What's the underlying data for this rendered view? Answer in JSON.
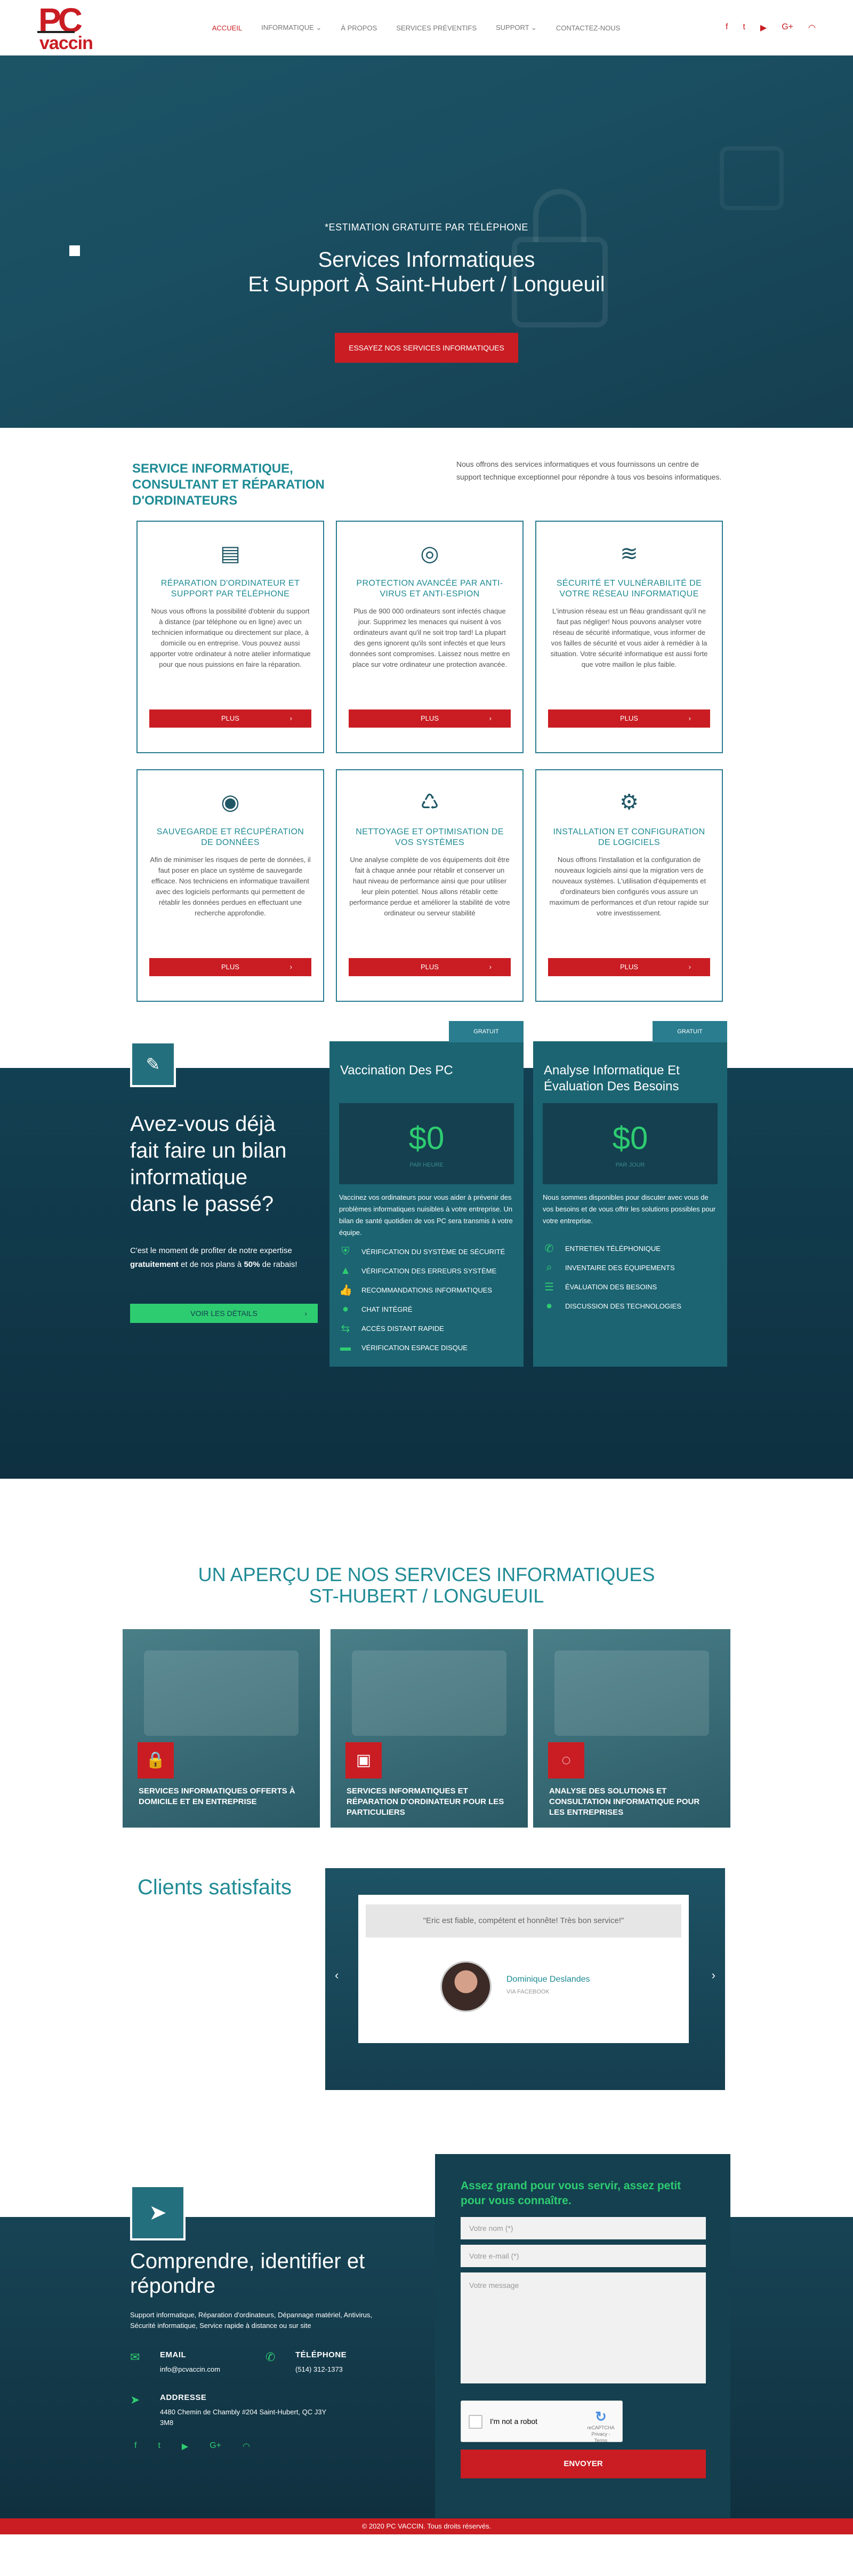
{
  "header": {
    "logo_top": "PC",
    "logo_bottom": "vaccin",
    "nav": [
      {
        "label": "ACCUEIL",
        "active": true
      },
      {
        "label": "INFORMATIQUE",
        "caret": true
      },
      {
        "label": "À PROPOS"
      },
      {
        "label": "SERVICES PRÉVENTIFS"
      },
      {
        "label": "SUPPORT",
        "caret": true
      },
      {
        "label": "CONTACTEZ-NOUS"
      }
    ],
    "social_icons": [
      "facebook-icon",
      "twitter-icon",
      "youtube-icon",
      "google-plus-icon",
      "rss-icon"
    ],
    "social_glyphs": [
      "f",
      "t",
      "▶",
      "G+",
      "◠"
    ]
  },
  "hero": {
    "eyebrow": "*ESTIMATION GRATUITE PAR TÉLÉPHONE",
    "title_line1": "Services Informatiques",
    "title_line2": "Et Support À Saint-Hubert / Longueuil",
    "cta": "ESSAYEZ NOS SERVICES INFORMATIQUES"
  },
  "services": {
    "title": "SERVICE INFORMATIQUE, CONSULTANT ET RÉPARATION D'ORDINATEURS",
    "intro": "Nous offrons des services informatiques et vous fournissons un centre de support technique exceptionnel pour répondre à tous vos besoins informatiques.",
    "cards": [
      {
        "icon": "id-card-icon",
        "glyph": "▤",
        "title": "RÉPARATION D'ORDINATEUR ET SUPPORT PAR TÉLÉPHONE",
        "text": "Nous vous offrons la possibilité d'obtenir du support à distance (par téléphone ou en ligne) avec un technicien informatique ou directement sur place, à domicile ou en entreprise. Vous pouvez aussi apporter votre ordinateur à notre atelier informatique pour que nous puissions en faire la réparation.",
        "button": "PLUS"
      },
      {
        "icon": "lifebuoy-icon",
        "glyph": "◎",
        "title": "PROTECTION AVANCÉE PAR ANTI-VIRUS ET ANTI-ESPION",
        "text": "Plus de 900 000 ordinateurs sont infectés chaque jour. Supprimez les menaces qui nuisent à vos ordinateurs avant qu'il ne soit trop tard! La plupart des gens ignorent qu'ils sont infectés et que leurs données sont compromises. Laissez nous mettre en place sur votre ordinateur une protection avancée.",
        "button": "PLUS"
      },
      {
        "icon": "stack-icon",
        "glyph": "≋",
        "title": "SÉCURITÉ ET VULNÉRABILITÉ DE VOTRE RÉSEAU INFORMATIQUE",
        "text": "L'intrusion réseau est un fléau grandissant qu'il ne faut pas négliger! Nous pouvons analyser votre réseau de sécurité informatique, vous informer de vos failles de sécurité et vous aider à remédier à la situation. Votre sécurité informatique est aussi forte que votre maillon le plus faible.",
        "button": "PLUS"
      },
      {
        "icon": "backup-icon",
        "glyph": "◉",
        "title": "SAUVEGARDE ET RÉCUPÉRATION DE DONNÉES",
        "text": "Afin de minimiser les risques de perte de données, il faut poser en place un système de sauvegarde efficace. Nos techniciens en informatique travaillent avec des logiciels performants qui permettent de rétablir les données perdues en effectuant une recherche approfondie.",
        "button": "PLUS"
      },
      {
        "icon": "recycle-icon",
        "glyph": "♺",
        "title": "NETTOYAGE ET OPTIMISATION DE VOS SYSTÈMES",
        "text": "Une analyse complète de vos équipements doit être fait à chaque année pour rétablir et conserver un haut niveau de performance ainsi que pour utiliser leur plein potentiel. Nous allons rétablir cette performance perdue et améliorer la stabilité de votre ordinateur ou serveur stabilité",
        "button": "PLUS"
      },
      {
        "icon": "gears-icon",
        "glyph": "⚙",
        "title": "INSTALLATION ET CONFIGURATION DE LOGICIELS",
        "text": "Nous offrons l'installation et la configuration de nouveaux logiciels ainsi que la migration vers de nouveaux systèmes. L'utilisation d'équipements et d'ordinateurs bien configurés vous assure un maximum de performances et d'un retour rapide sur votre investissement.",
        "button": "PLUS"
      }
    ]
  },
  "pricing": {
    "icon_glyph": "✎",
    "title": "Avez-vous déjà fait faire un bilan informatique dans le passé?",
    "para_before": "C'est le moment de profiter de notre expertise ",
    "para_bold1": "gratuitement",
    "para_mid": " et de nos plans à ",
    "para_bold2": "50%",
    "para_after": " de rabais!",
    "details": "VOIR LES DÉTAILS",
    "boxes": [
      {
        "badge": "GRATUIT",
        "title": "Vaccination Des PC",
        "amount": "$0",
        "sub": "PAR HEURE",
        "desc": "Vaccinez vos ordinateurs pour vous aider à prévenir des problèmes informatiques nuisibles à votre entreprise. Un bilan de santé quotidien de vos PC sera transmis à votre équipe.",
        "features": [
          {
            "icon": "shield-icon",
            "glyph": "⛨",
            "label": "VÉRIFICATION DU SYSTÈME DE SÉCURITÉ"
          },
          {
            "icon": "warning-icon",
            "glyph": "▲",
            "label": "VÉRIFICATION DES ERREURS SYSTÈME"
          },
          {
            "icon": "thumbs-up-icon",
            "glyph": "👍",
            "label": "RECOMMANDATIONS INFORMATIQUES"
          },
          {
            "icon": "chat-icon",
            "glyph": "●",
            "label": "CHAT INTÉGRÉ"
          },
          {
            "icon": "remote-access-icon",
            "glyph": "⇆",
            "label": "ACCÈS DISTANT RAPIDE"
          },
          {
            "icon": "disk-icon",
            "glyph": "▬",
            "label": "VÉRIFICATION ESPACE DISQUE"
          }
        ]
      },
      {
        "badge": "GRATUIT",
        "title": "Analyse Informatique Et Évaluation Des Besoins",
        "amount": "$0",
        "sub": "PAR JOUR",
        "desc": "Nous sommes disponibles pour discuter avec vous de vos besoins et de vous offrir les solutions possibles pour votre entreprise.",
        "features": [
          {
            "icon": "phone-icon",
            "glyph": "✆",
            "label": "ENTRETIEN TÉLÉPHONIQUE"
          },
          {
            "icon": "search-icon",
            "glyph": "⌕",
            "label": "INVENTAIRE DES ÉQUIPEMENTS"
          },
          {
            "icon": "list-icon",
            "glyph": "☰",
            "label": "ÉVALUATION DES BESOINS"
          },
          {
            "icon": "chat-icon",
            "glyph": "●",
            "label": "DISCUSSION DES TECHNOLOGIES"
          }
        ]
      }
    ]
  },
  "overview": {
    "title_line1": "UN APERÇU DE NOS SERVICES INFORMATIQUES",
    "title_line2": "ST-HUBERT / LONGUEUIL",
    "tiles": [
      {
        "icon": "lock-icon",
        "glyph": "🔒",
        "caption": "SERVICES INFORMATIQUES OFFERTS À DOMICILE ET EN ENTREPRISE"
      },
      {
        "icon": "chip-icon",
        "glyph": "▣",
        "caption": "SERVICES INFORMATIQUES ET RÉPARATION D'ORDINATEUR POUR LES PARTICULIERS"
      },
      {
        "icon": "eye-slash-icon",
        "glyph": "◌",
        "caption": "ANALYSE DES SOLUTIONS ET CONSULTATION INFORMATIQUE POUR LES ENTREPRISES"
      }
    ]
  },
  "clients": {
    "title": "Clients satisfaits",
    "quote": "\"Eric est fiable, compétent et honnête! Très bon service!\"",
    "name": "Dominique Deslandes",
    "via": "VIA FACEBOOK",
    "prev": "‹",
    "next": "›"
  },
  "contact": {
    "icon_glyph": "➤",
    "title": "Comprendre, identifier et répondre",
    "tags": "Support informatique, Réparation d'ordinateurs, Dépannage matériel, Antivirus, Sécurité informatique, Service rapide à distance ou sur site",
    "email_label": "EMAIL",
    "email": "info@pcvaccin.com",
    "phone_label": "TÉLÉPHONE",
    "phone": "(514) 312-1373",
    "address_label": "ADDRESSE",
    "address": "4480 Chemin de Chambly #204 Saint-Hubert, QC J3Y 3M8",
    "social_glyphs": [
      "f",
      "t",
      "▶",
      "G+",
      "◠"
    ],
    "form": {
      "title": "Assez grand pour vous servir, assez petit pour vous connaître.",
      "name_placeholder": "Votre nom (*)",
      "email_placeholder": "Votre e-mail (*)",
      "message_placeholder": "Votre message",
      "captcha_label": "I'm not a robot",
      "captcha_brand": "reCAPTCHA",
      "captcha_terms": "Privacy - Terms",
      "send": "ENVOYER"
    }
  },
  "footer": {
    "copyright": "© 2020 PC VACCIN. Tous droits réservés."
  }
}
